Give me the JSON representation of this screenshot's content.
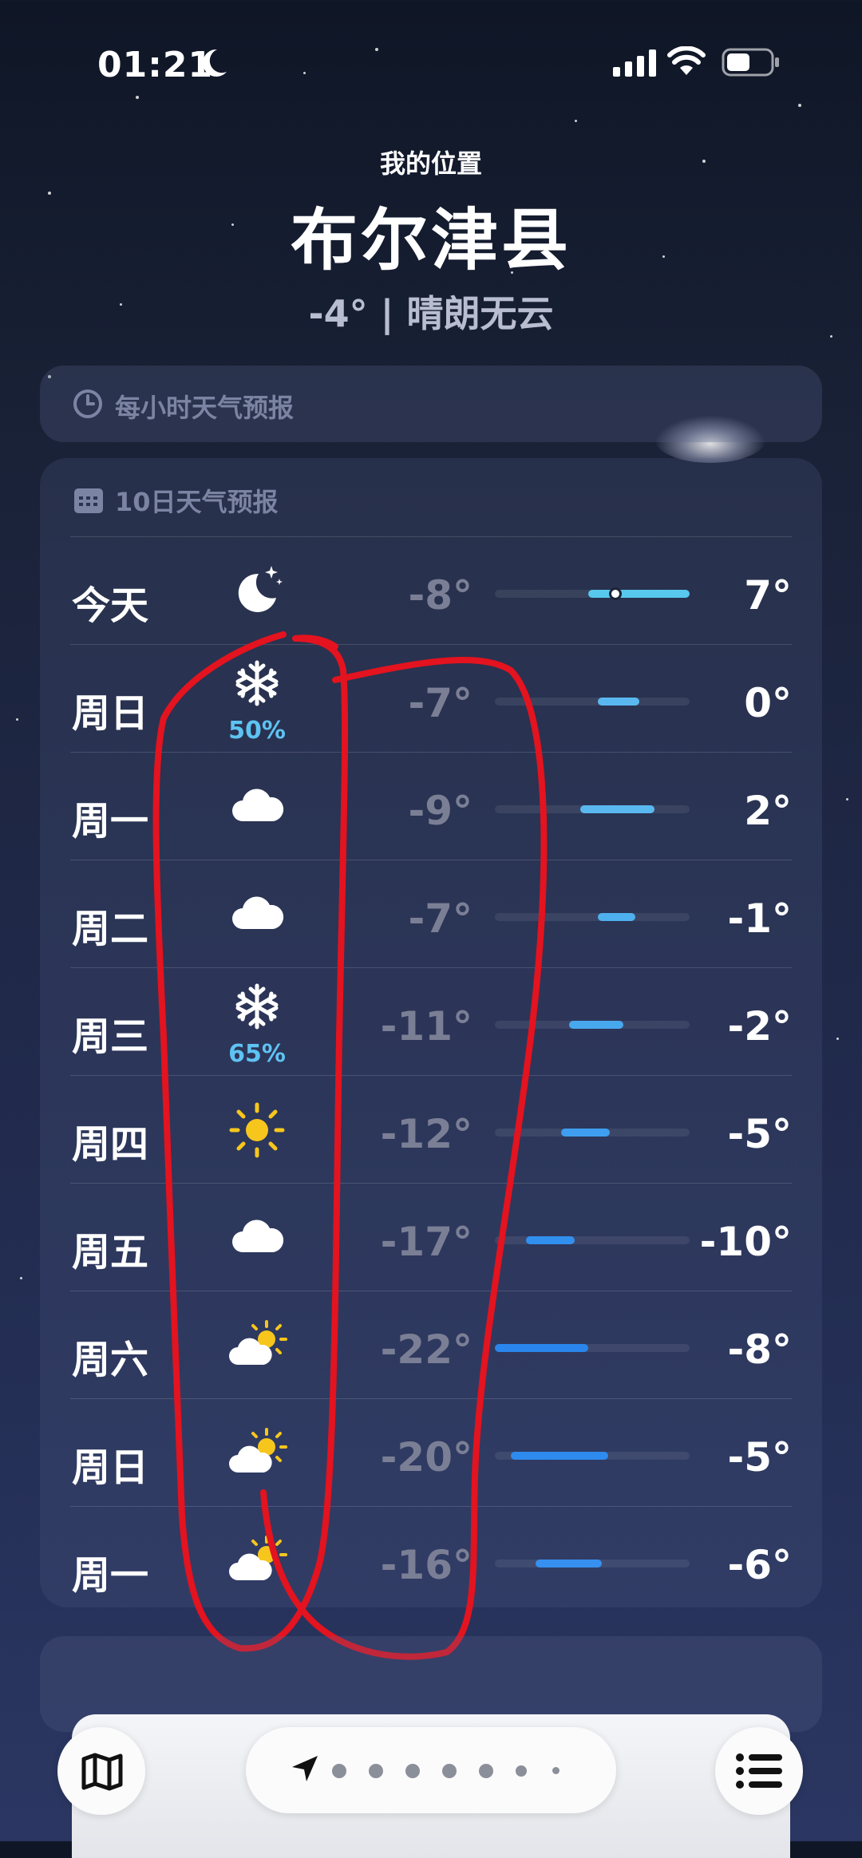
{
  "status_bar": {
    "time": "01:21",
    "icons": [
      "moon-icon",
      "cellular-signal-icon",
      "wifi-icon",
      "battery-icon"
    ]
  },
  "location": {
    "label": "我的位置",
    "city": "布尔津县",
    "current": "-4° | 晴朗无云"
  },
  "hourly": {
    "icon": "clock-icon",
    "title": "每小时天气预报"
  },
  "daily": {
    "icon": "calendar-icon",
    "title": "10日天气预报",
    "rows": [
      {
        "day": "今天",
        "icon": "moon-stars-icon",
        "precip": "",
        "low": "-8°",
        "high": "7°",
        "bar": [
          0.48,
          1.0
        ],
        "current": 0.62,
        "color": "#58c8ee"
      },
      {
        "day": "周日",
        "icon": "snowflake-icon",
        "precip": "50%",
        "low": "-7°",
        "high": "0°",
        "bar": [
          0.53,
          0.74
        ],
        "current": null,
        "color": "#5ab8f0"
      },
      {
        "day": "周一",
        "icon": "cloud-icon",
        "precip": "",
        "low": "-9°",
        "high": "2°",
        "bar": [
          0.44,
          0.82
        ],
        "current": null,
        "color": "#5ab8f0"
      },
      {
        "day": "周二",
        "icon": "cloud-icon",
        "precip": "",
        "low": "-7°",
        "high": "-1°",
        "bar": [
          0.53,
          0.72
        ],
        "current": null,
        "color": "#4fb0ee"
      },
      {
        "day": "周三",
        "icon": "snowflake-icon",
        "precip": "65%",
        "low": "-11°",
        "high": "-2°",
        "bar": [
          0.38,
          0.66
        ],
        "current": null,
        "color": "#48a8ee"
      },
      {
        "day": "周四",
        "icon": "sun-icon",
        "precip": "",
        "low": "-12°",
        "high": "-5°",
        "bar": [
          0.34,
          0.59
        ],
        "current": null,
        "color": "#3f9ef0"
      },
      {
        "day": "周五",
        "icon": "cloud-icon",
        "precip": "",
        "low": "-17°",
        "high": "-10°",
        "bar": [
          0.16,
          0.41
        ],
        "current": null,
        "color": "#3190ee"
      },
      {
        "day": "周六",
        "icon": "partly-cloudy-icon",
        "precip": "",
        "low": "-22°",
        "high": "-8°",
        "bar": [
          0.0,
          0.48
        ],
        "current": null,
        "color": "#2a86ec"
      },
      {
        "day": "周日",
        "icon": "partly-cloudy-icon",
        "precip": "",
        "low": "-20°",
        "high": "-5°",
        "bar": [
          0.08,
          0.58
        ],
        "current": null,
        "color": "#2e8aee"
      },
      {
        "day": "周一",
        "icon": "partly-cloudy-icon",
        "precip": "",
        "low": "-16°",
        "high": "-6°",
        "bar": [
          0.21,
          0.55
        ],
        "current": null,
        "color": "#3690ef"
      }
    ]
  },
  "bottom_bar": {
    "left": "map-icon",
    "right": "list-icon",
    "pager_pages": 7,
    "pager_active": "location-arrow-icon"
  }
}
